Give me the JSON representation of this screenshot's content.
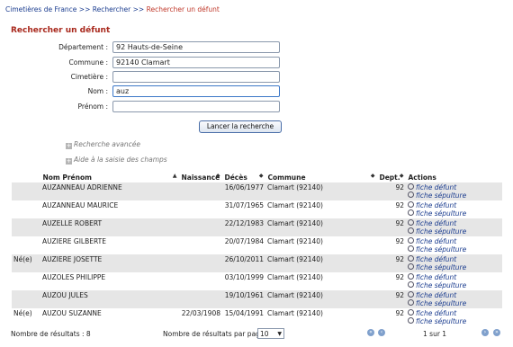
{
  "breadcrumb": {
    "items": [
      "Cimetières de France",
      "Rechercher",
      "Rechercher un défunt"
    ],
    "separator": ">>"
  },
  "page_title": "Rechercher un défunt",
  "form": {
    "departement": {
      "label": "Département :",
      "value": "92 Hauts-de-Seine"
    },
    "commune": {
      "label": "Commune :",
      "value": "92140 Clamart"
    },
    "cimetiere": {
      "label": "Cimetière :",
      "value": ""
    },
    "nom": {
      "label": "Nom :",
      "value": "auz"
    },
    "prenom": {
      "label": "Prénom :",
      "value": ""
    },
    "submit_label": "Lancer la recherche",
    "advanced_label": "Recherche avancée",
    "help_label": "Aide à la saisie des champs"
  },
  "table": {
    "headers": [
      "",
      "Nom Prénom",
      "Naissance",
      "Décès",
      "Commune",
      "Dept.",
      "Actions"
    ],
    "action_labels": [
      "fiche défunt",
      "fiche sépulture"
    ],
    "rows": [
      {
        "prefix": "",
        "name": "AUZANNEAU ADRIENNE",
        "birth": "",
        "death": "16/06/1977",
        "commune": "Clamart (92140)",
        "dept": "92"
      },
      {
        "prefix": "",
        "name": "AUZANNEAU MAURICE",
        "birth": "",
        "death": "31/07/1965",
        "commune": "Clamart (92140)",
        "dept": "92"
      },
      {
        "prefix": "",
        "name": "AUZELLE ROBERT",
        "birth": "",
        "death": "22/12/1983",
        "commune": "Clamart (92140)",
        "dept": "92"
      },
      {
        "prefix": "",
        "name": "AUZIERE GILBERTE",
        "birth": "",
        "death": "20/07/1984",
        "commune": "Clamart (92140)",
        "dept": "92"
      },
      {
        "prefix": "Né(e)",
        "name": "AUZIERE JOSETTE",
        "birth": "",
        "death": "26/10/2011",
        "commune": "Clamart (92140)",
        "dept": "92"
      },
      {
        "prefix": "",
        "name": "AUZOLES PHILIPPE",
        "birth": "",
        "death": "03/10/1999",
        "commune": "Clamart (92140)",
        "dept": "92"
      },
      {
        "prefix": "",
        "name": "AUZOU JULES",
        "birth": "",
        "death": "19/10/1961",
        "commune": "Clamart (92140)",
        "dept": "92"
      },
      {
        "prefix": "Né(e)",
        "name": "AUZOU SUZANNE",
        "birth": "22/03/1908",
        "death": "15/04/1991",
        "commune": "Clamart (92140)",
        "dept": "92"
      }
    ]
  },
  "footer": {
    "results_label": "Nombre de résultats : 8",
    "per_page_label": "Nombre de résultats par page :",
    "per_page_value": "10",
    "page_info": "1 sur 1"
  }
}
